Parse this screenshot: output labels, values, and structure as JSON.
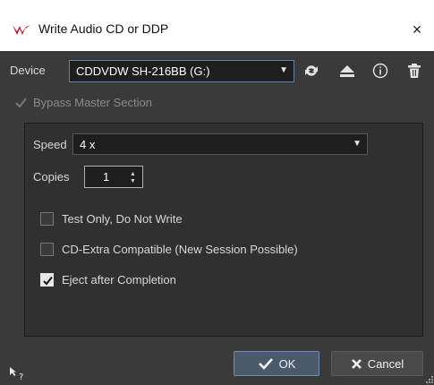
{
  "window": {
    "title": "Write Audio CD or DDP",
    "close_glyph": "×",
    "logo_icon": "wavelab-logo-icon",
    "logo_color": "#c4122f"
  },
  "device": {
    "label": "Device",
    "value": "CDDVDW SH-216BB (G:)",
    "dropdown_glyph": "▼",
    "icons": [
      "refresh-icon",
      "eject-icon",
      "info-icon",
      "trash-icon"
    ]
  },
  "bypass": {
    "label": "Bypass Master Section",
    "checked": true,
    "disabled": true
  },
  "options": {
    "speed_label": "Speed",
    "speed_value": "4 x",
    "speed_glyph": "▼",
    "copies_label": "Copies",
    "copies_value": "1",
    "checkboxes": [
      {
        "label": "Test Only, Do Not Write",
        "checked": false
      },
      {
        "label": "CD-Extra Compatible (New Session Possible)",
        "checked": false
      },
      {
        "label": "Eject after Completion",
        "checked": true
      }
    ]
  },
  "buttons": {
    "ok": "OK",
    "cancel": "Cancel"
  },
  "colors": {
    "background": "#3a3a3a",
    "accent": "#5e86b0",
    "text": "#d8d8d8"
  }
}
